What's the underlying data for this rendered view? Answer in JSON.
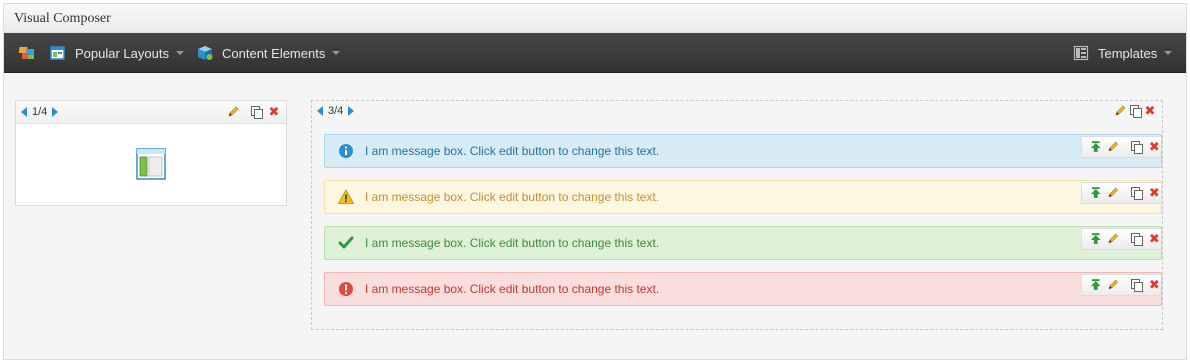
{
  "panel": {
    "title": "Visual Composer"
  },
  "navbar": {
    "popular_layouts": "Popular Layouts",
    "content_elements": "Content Elements",
    "templates": "Templates"
  },
  "columns": {
    "left": {
      "size": "1/4"
    },
    "right": {
      "size": "3/4"
    }
  },
  "messages": [
    {
      "type": "info",
      "text": "I am message box. Click edit button to change this text.",
      "color": "#21759b",
      "bg": "#d8ecf6",
      "border": "#a8d5ec"
    },
    {
      "type": "warning",
      "text": "I am message box. Click edit button to change this text.",
      "color": "#c39135",
      "bg": "#fdf6e1",
      "border": "#f3e2b0"
    },
    {
      "type": "success",
      "text": "I am message box. Click edit button to change this text.",
      "color": "#3f8b3a",
      "bg": "#def0d8",
      "border": "#b9dfaa"
    },
    {
      "type": "error",
      "text": "I am message box. Click edit button to change this text.",
      "color": "#c8342c",
      "bg": "#f9dede",
      "border": "#f0b6b6"
    }
  ],
  "icons": {
    "logo": "vc-logo-icon",
    "layouts": "layout-icon",
    "elements": "elements-cube-icon",
    "templates": "templates-icon",
    "edit": "pencil-icon",
    "clone": "copy-icon",
    "delete": "close-icon",
    "move": "move-arrow-icon",
    "column_placeholder": "column-layout-icon"
  }
}
